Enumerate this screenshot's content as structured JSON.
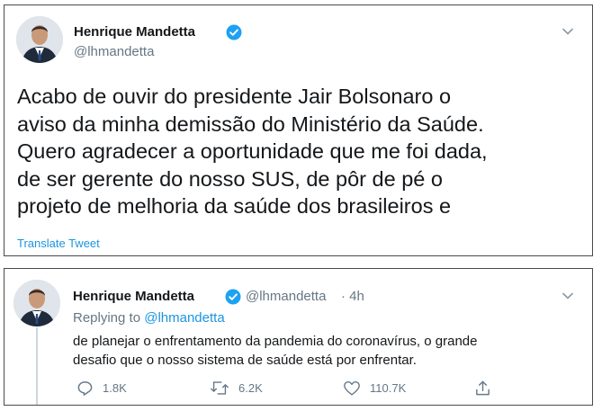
{
  "tweet1": {
    "author_name": "Henrique Mandetta",
    "author_handle": "@lhmandetta",
    "text_lines": [
      "Acabo de ouvir do presidente Jair Bolsonaro o",
      "aviso da minha demissão do Ministério da Saúde.",
      "Quero agradecer a oportunidade que me foi dada,",
      "de ser gerente do nosso SUS, de pôr de pé o",
      "projeto de melhoria da saúde dos brasileiros e"
    ],
    "translate_label": "Translate Tweet",
    "icons": {
      "verified": "verified-badge-icon",
      "menu": "chevron-down-icon"
    },
    "colors": {
      "link": "#1b95e0",
      "verified": "#1da1f2"
    }
  },
  "tweet2": {
    "author_name": "Henrique Mandetta",
    "author_handle": "@lhmandetta",
    "timestamp": "· 4h",
    "replying_prefix": "Replying to",
    "replying_mention": "@lhmandetta",
    "text_lines": [
      "de planejar o enfrentamento da pandemia do coronavírus, o grande",
      "desafio que o nosso sistema de saúde está por enfrentar."
    ],
    "actions": {
      "reply_count": "1.8K",
      "retweet_count": "6.2K",
      "like_count": "110.7K"
    },
    "icons": {
      "reply": "reply-icon",
      "retweet": "retweet-icon",
      "like": "heart-icon",
      "share": "share-icon"
    }
  }
}
